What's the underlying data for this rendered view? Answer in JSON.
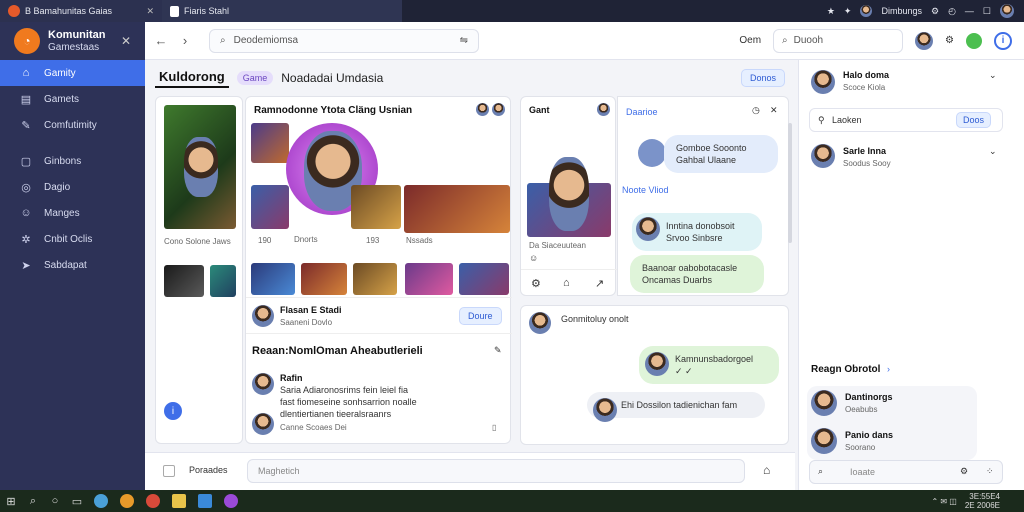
{
  "browser": {
    "tab1_title": "Β Βamahunitas Gaias",
    "tab2_title": "Fiaris Stahl",
    "right_label": "Dimbungs"
  },
  "sidebar": {
    "app_name": "Komunitan",
    "app_sub": "Gamestaas",
    "items": [
      {
        "label": "Gamity",
        "icon": "gamepad-icon",
        "active": true
      },
      {
        "label": "Gamets",
        "icon": "list-icon",
        "active": false
      },
      {
        "label": "Comfutimity",
        "icon": "pen-icon",
        "active": false
      },
      {
        "label": "Ginbons",
        "icon": "chat-icon",
        "active": false
      },
      {
        "label": "Dagio",
        "icon": "globe-icon",
        "active": false
      },
      {
        "label": "Manges",
        "icon": "people-icon",
        "active": false
      },
      {
        "label": "Cnbit Oclis",
        "icon": "settings-icon",
        "active": false
      },
      {
        "label": "Sabdapat",
        "icon": "send-icon",
        "active": false
      }
    ]
  },
  "toolbar": {
    "address": "Deodemiomsa",
    "clock": "Oem",
    "search_placeholder": "Duooh"
  },
  "header": {
    "title": "Kuldorong",
    "pill": "Game",
    "subtitle": "Noadadai Umdasia",
    "action": "Donos"
  },
  "left_card": {
    "caption": "Cono Solone Jaws"
  },
  "center_card": {
    "title": "Ramnodonne Ytota Cläng Usnian",
    "stat1": "190",
    "stat2": "Dnorts",
    "stat3": "193",
    "stat4": "Nssads",
    "player_name": "Flasan E Stadi",
    "player_sub": "Saaneni Dovlo",
    "follow": "Doure",
    "section_title": "Reaan:NomlOman Aheabutlerieli",
    "post_name": "Rafin",
    "post_line1": "Saria Adiaronosrims fein leiel fia",
    "post_line2": "fast fiomeseine sonhsarrion noalle",
    "post_line3": "dlentiertianen tieeralsraanrs",
    "post_footer": "Canne  Scoaes Dei"
  },
  "mid_card": {
    "title": "Gant",
    "caption": "Da Siaceuutean"
  },
  "chat": {
    "header": "Daarioe",
    "messages": [
      {
        "line1": "Gomboe Sooonto",
        "line2": "Gahbal Ulaane",
        "style": "blue"
      },
      {
        "line1": "Noote Vliod",
        "line2": "",
        "style": "label"
      },
      {
        "line1": "Inntina donobsoit",
        "line2": "Srvoo Sinbsre",
        "style": "cyan"
      },
      {
        "line1": "Baanoar oabobotacasle",
        "line2": "Oncamas Duarbs",
        "style": "green"
      }
    ],
    "bottom_header": "Gonmitoluy onolt",
    "bottom_msg1": "Kamnunsbadorgoel",
    "bottom_msg2": "Ehi Dossilon tadienichan fam"
  },
  "composer": {
    "label": "Poraades",
    "placeholder": "Maghetich"
  },
  "right_panel": {
    "user1": "Halo doma",
    "user1_sub": "Scoce Kiola",
    "field": "Laoken",
    "field_btn": "Doos",
    "user2": "Sarle Inna",
    "user2_sub": "Soodus Sooy",
    "section": "Reagn Obrotol",
    "friend1": "Dantinorgs",
    "friend1_sub": "Oeabubs",
    "friend2": "Panio dans",
    "friend2_sub": "Soorano",
    "input": "Ioaate"
  },
  "taskbar": {
    "time": "3E:55E4",
    "date": "2E 2006E"
  }
}
